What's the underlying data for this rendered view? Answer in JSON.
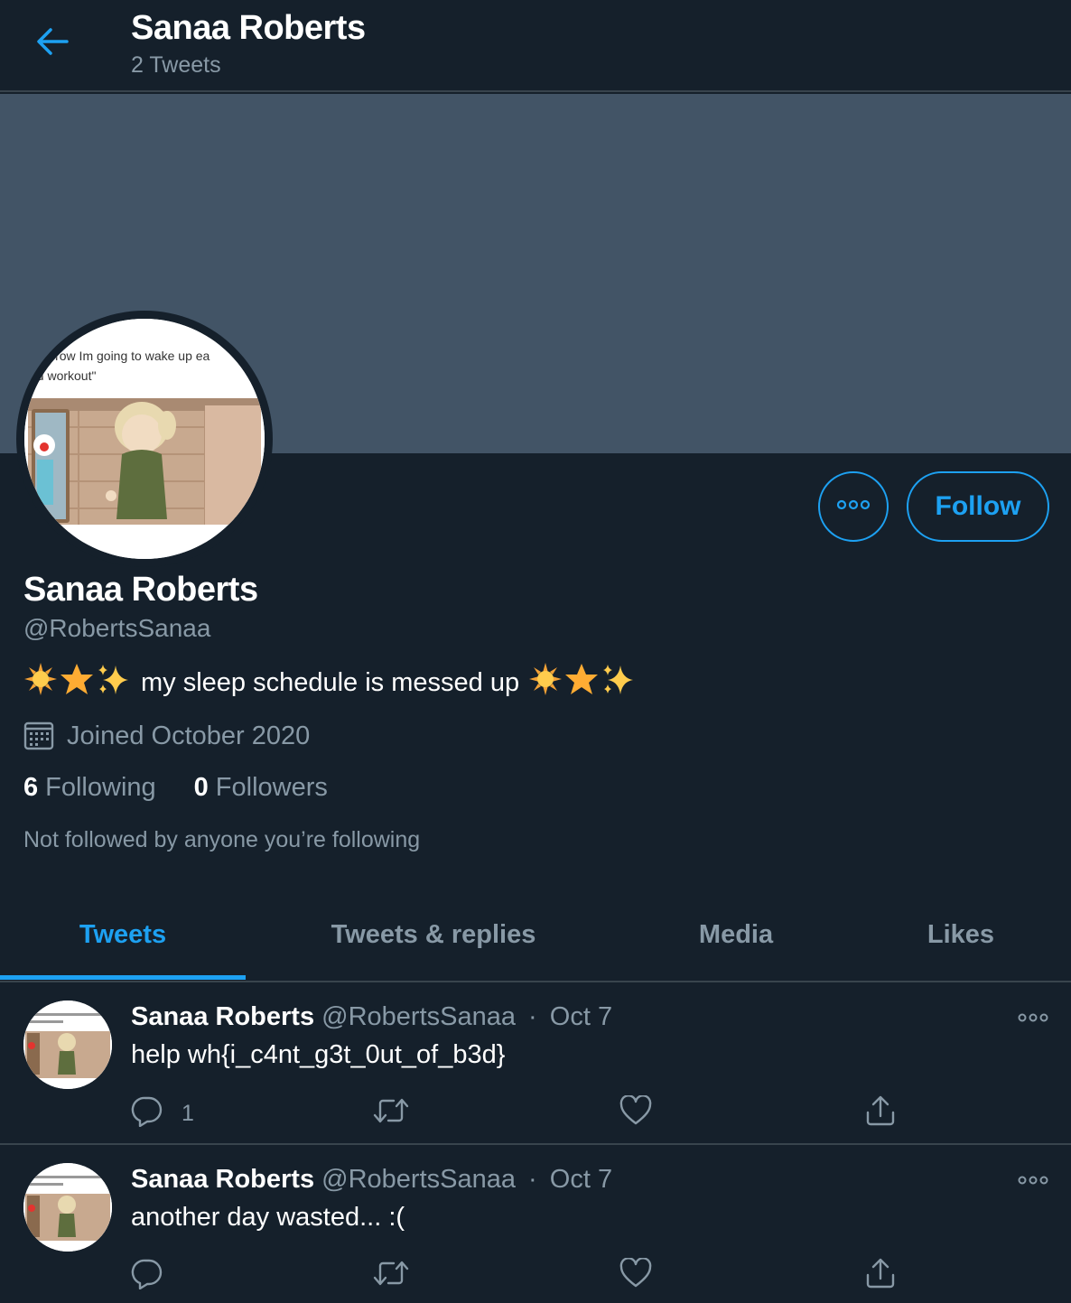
{
  "header": {
    "title": "Sanaa Roberts",
    "subtitle": "2 Tweets",
    "back_icon": "arrow-left-icon"
  },
  "colors": {
    "background": "#15202b",
    "banner": "#425466",
    "accent": "#1da1f2",
    "muted": "#8899a6",
    "divider": "#38444d"
  },
  "profile": {
    "avatar_caption_line1": "morrow Im going to wake up ea",
    "avatar_caption_line2": "nd workout\"",
    "more_icon": "more-horizontal-icon",
    "follow_label": "Follow",
    "name": "Sanaa Roberts",
    "handle": "@RobertsSanaa",
    "bio_emoji_before": [
      "sun-emoji",
      "star-emoji",
      "sparkles-emoji"
    ],
    "bio_text": "my sleep schedule is messed up",
    "bio_emoji_after": [
      "sun-emoji",
      "star-emoji",
      "sparkles-emoji"
    ],
    "joined_icon": "calendar-icon",
    "joined": "Joined October 2020",
    "following_count": "6",
    "following_label": "Following",
    "followers_count": "0",
    "followers_label": "Followers",
    "not_followed": "Not followed by anyone you’re following"
  },
  "tabs": [
    {
      "label": "Tweets",
      "active": true
    },
    {
      "label": "Tweets & replies",
      "active": false
    },
    {
      "label": "Media",
      "active": false
    },
    {
      "label": "Likes",
      "active": false
    }
  ],
  "tweets": [
    {
      "name": "Sanaa Roberts",
      "handle": "@RobertsSanaa",
      "separator": "·",
      "date": "Oct 7",
      "text": "help wh{i_c4nt_g3t_0ut_of_b3d}",
      "reply_count": "1"
    },
    {
      "name": "Sanaa Roberts",
      "handle": "@RobertsSanaa",
      "separator": "·",
      "date": "Oct 7",
      "text": "another day wasted... :(",
      "reply_count": ""
    }
  ]
}
